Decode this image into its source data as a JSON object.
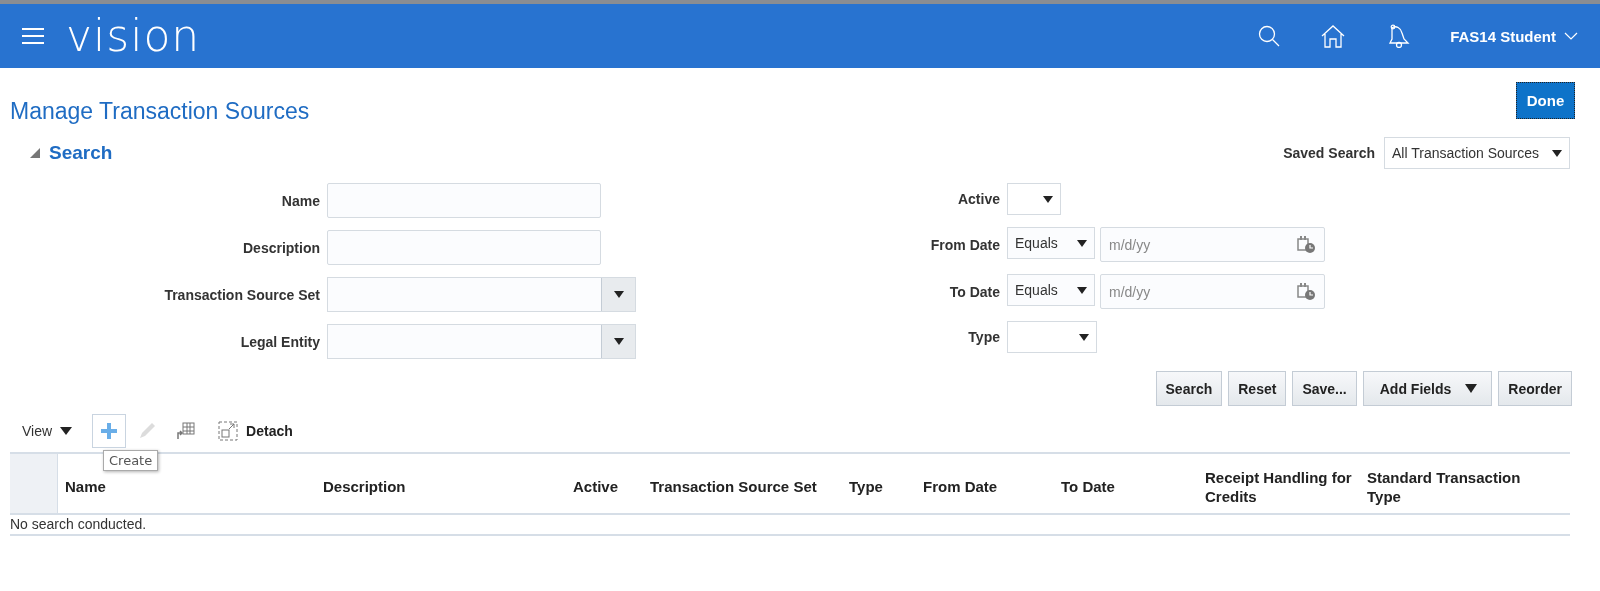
{
  "header": {
    "logo": "vision",
    "user": "FAS14 Student"
  },
  "page": {
    "title": "Manage Transaction Sources",
    "done": "Done"
  },
  "search": {
    "title": "Search",
    "expanded": true,
    "saved_search": {
      "label": "Saved Search",
      "value": "All Transaction Sources"
    },
    "fields_left": [
      {
        "label": "Name",
        "kind": "text"
      },
      {
        "label": "Description",
        "kind": "text"
      },
      {
        "label": "Transaction Source Set",
        "kind": "combo"
      },
      {
        "label": "Legal Entity",
        "kind": "combo"
      }
    ],
    "fields_right": [
      {
        "label": "Active",
        "kind": "short_choice"
      },
      {
        "label": "From Date",
        "kind": "date",
        "operator": "Equals",
        "placeholder": "m/d/yy"
      },
      {
        "label": "To Date",
        "kind": "date",
        "operator": "Equals",
        "placeholder": "m/d/yy"
      },
      {
        "label": "Type",
        "kind": "choice"
      }
    ],
    "buttons": [
      {
        "label": "Search",
        "kind": "plain"
      },
      {
        "label": "Reset",
        "kind": "plain"
      },
      {
        "label": "Save...",
        "kind": "plain"
      },
      {
        "label": "Add Fields",
        "kind": "menu"
      },
      {
        "label": "Reorder",
        "kind": "plain"
      }
    ]
  },
  "toolbar": {
    "view": "View",
    "tools": [
      {
        "kind": "create",
        "disabled": false
      },
      {
        "kind": "edit",
        "disabled": true
      },
      {
        "kind": "export",
        "disabled": false
      }
    ],
    "detach": "Detach",
    "tooltip": "Create"
  },
  "table": {
    "columns": [
      "Name",
      "Description",
      "Active",
      "Transaction Source Set",
      "Type",
      "From Date",
      "To Date",
      "Receipt Handling for Credits",
      "Standard Transaction Type"
    ],
    "empty_text": "No search conducted."
  }
}
